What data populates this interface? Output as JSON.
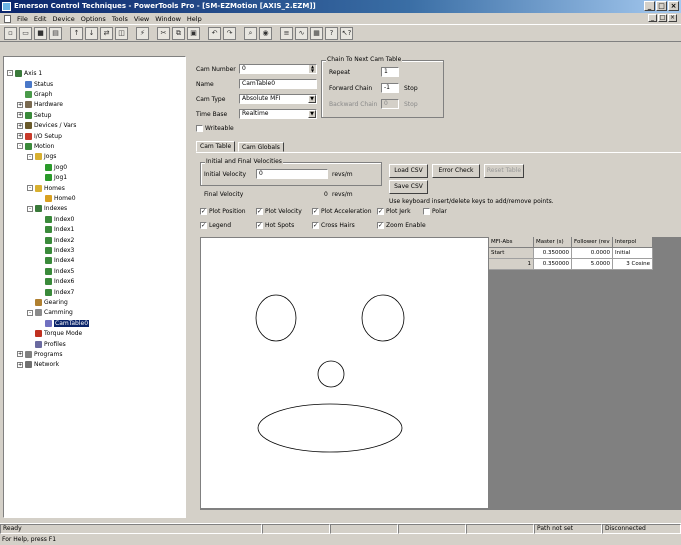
{
  "window": {
    "title": "Emerson Control Techniques - PowerTools Pro - [SM-EZMotion  [AXIS_2.EZM]]",
    "controls": {
      "minimize": "_",
      "maximize": "□",
      "close": "×"
    }
  },
  "menu": [
    "File",
    "Edit",
    "Device",
    "Options",
    "Tools",
    "View",
    "Window",
    "Help"
  ],
  "toolbar_icons": [
    "new-icon",
    "open-icon",
    "save-icon",
    "print-icon",
    "upload-icon",
    "download-icon",
    "compare-icon",
    "disconnect-icon",
    "connect-icon",
    "cut-icon",
    "copy-icon",
    "paste-icon",
    "undo-icon",
    "redo-icon",
    "find-icon",
    "watch-icon",
    "program-icon",
    "scope-icon",
    "status-icon",
    "help-icon",
    "whats-this-icon"
  ],
  "tree": {
    "root": "Axis 1",
    "items": [
      {
        "label": "Status",
        "depth": 1,
        "icon": "status"
      },
      {
        "label": "Graph",
        "depth": 1,
        "icon": "graph"
      },
      {
        "label": "Hardware",
        "depth": 1,
        "icon": "hardware",
        "expander": "+"
      },
      {
        "label": "Setup",
        "depth": 1,
        "icon": "setup",
        "expander": "+"
      },
      {
        "label": "Devices / Vars",
        "depth": 1,
        "icon": "devices",
        "expander": "+"
      },
      {
        "label": "I/O Setup",
        "depth": 1,
        "icon": "io",
        "expander": "+"
      },
      {
        "label": "Motion",
        "depth": 1,
        "icon": "motion",
        "expander": "-"
      },
      {
        "label": "Jogs",
        "depth": 2,
        "icon": "folder",
        "expander": "-"
      },
      {
        "label": "Jog0",
        "depth": 3,
        "icon": "jog"
      },
      {
        "label": "Jog1",
        "depth": 3,
        "icon": "jog"
      },
      {
        "label": "Homes",
        "depth": 2,
        "icon": "folder",
        "expander": "-"
      },
      {
        "label": "Home0",
        "depth": 3,
        "icon": "home"
      },
      {
        "label": "Indexes",
        "depth": 2,
        "icon": "index",
        "expander": "-"
      },
      {
        "label": "Index0",
        "depth": 3,
        "icon": "idx"
      },
      {
        "label": "Index1",
        "depth": 3,
        "icon": "idx"
      },
      {
        "label": "Index2",
        "depth": 3,
        "icon": "idx"
      },
      {
        "label": "Index3",
        "depth": 3,
        "icon": "idx"
      },
      {
        "label": "Index4",
        "depth": 3,
        "icon": "idx"
      },
      {
        "label": "Index5",
        "depth": 3,
        "icon": "idx"
      },
      {
        "label": "Index6",
        "depth": 3,
        "icon": "idx"
      },
      {
        "label": "Index7",
        "depth": 3,
        "icon": "idx"
      },
      {
        "label": "Gearing",
        "depth": 2,
        "icon": "gear"
      },
      {
        "label": "Camming",
        "depth": 2,
        "icon": "cam",
        "expander": "-"
      },
      {
        "label": "CamTable0",
        "depth": 3,
        "icon": "camtable",
        "selected": true
      },
      {
        "label": "Torque Mode",
        "depth": 2,
        "icon": "torque"
      },
      {
        "label": "Profiles",
        "depth": 2,
        "icon": "profile"
      },
      {
        "label": "Programs",
        "depth": 1,
        "icon": "program",
        "expander": "+"
      },
      {
        "label": "Network",
        "depth": 1,
        "icon": "network",
        "expander": "+"
      }
    ]
  },
  "cam": {
    "number_label": "Cam Number",
    "number_value": "0",
    "name_label": "Name",
    "name_value": "CamTable0",
    "type_label": "Cam Type",
    "type_value": "Absolute MFI",
    "timebase_label": "Time Base",
    "timebase_value": "Realtime",
    "writeable_label": "Writeable"
  },
  "chain": {
    "group_title": "Chain To Next Cam Table",
    "repeat_label": "Repeat",
    "repeat_value": "1",
    "forward_label": "Forward Chain",
    "forward_value": "-1",
    "forward_status": "Stop",
    "backward_label": "Backward Chain",
    "backward_value": "0",
    "backward_status": "Stop"
  },
  "tabs": [
    "Cam Table",
    "Cam Globals"
  ],
  "velocities": {
    "group_title": "Initial and Final Velocities",
    "initial_label": "Initial Velocity",
    "initial_value": "0",
    "initial_unit": "revs/m",
    "final_label": "Final Velocity",
    "final_value": "0",
    "final_unit": "revs/m"
  },
  "buttons": {
    "load_csv": "Load CSV",
    "error_check": "Error Check",
    "reset_table": "Reset Table",
    "save_csv": "Save CSV"
  },
  "hint": "Use keyboard insert/delete keys to add/remove points.",
  "plot_options": [
    {
      "label": "Plot Position",
      "checked": true
    },
    {
      "label": "Plot Velocity",
      "checked": true
    },
    {
      "label": "Plot Acceleration",
      "checked": true
    },
    {
      "label": "Plot Jerk",
      "checked": true
    },
    {
      "label": "Polar",
      "checked": false
    },
    {
      "label": "Legend",
      "checked": true
    },
    {
      "label": "Hot Spots",
      "checked": true
    },
    {
      "label": "Cross Hairs",
      "checked": true
    },
    {
      "label": "Zoom Enable",
      "checked": true
    }
  ],
  "table": {
    "headers": [
      "MFI-Abs",
      "Master (s)",
      "Follower (rev",
      "Interpol"
    ],
    "rows": [
      [
        "Start",
        "0.350000",
        "0.0000",
        "Initial"
      ],
      [
        "1",
        "0.350000",
        "5.0000",
        "3 Cosine"
      ]
    ]
  },
  "status": {
    "ready": "Ready",
    "path": "Path not set",
    "connection": "Disconnected",
    "help": "For Help, press F1"
  }
}
